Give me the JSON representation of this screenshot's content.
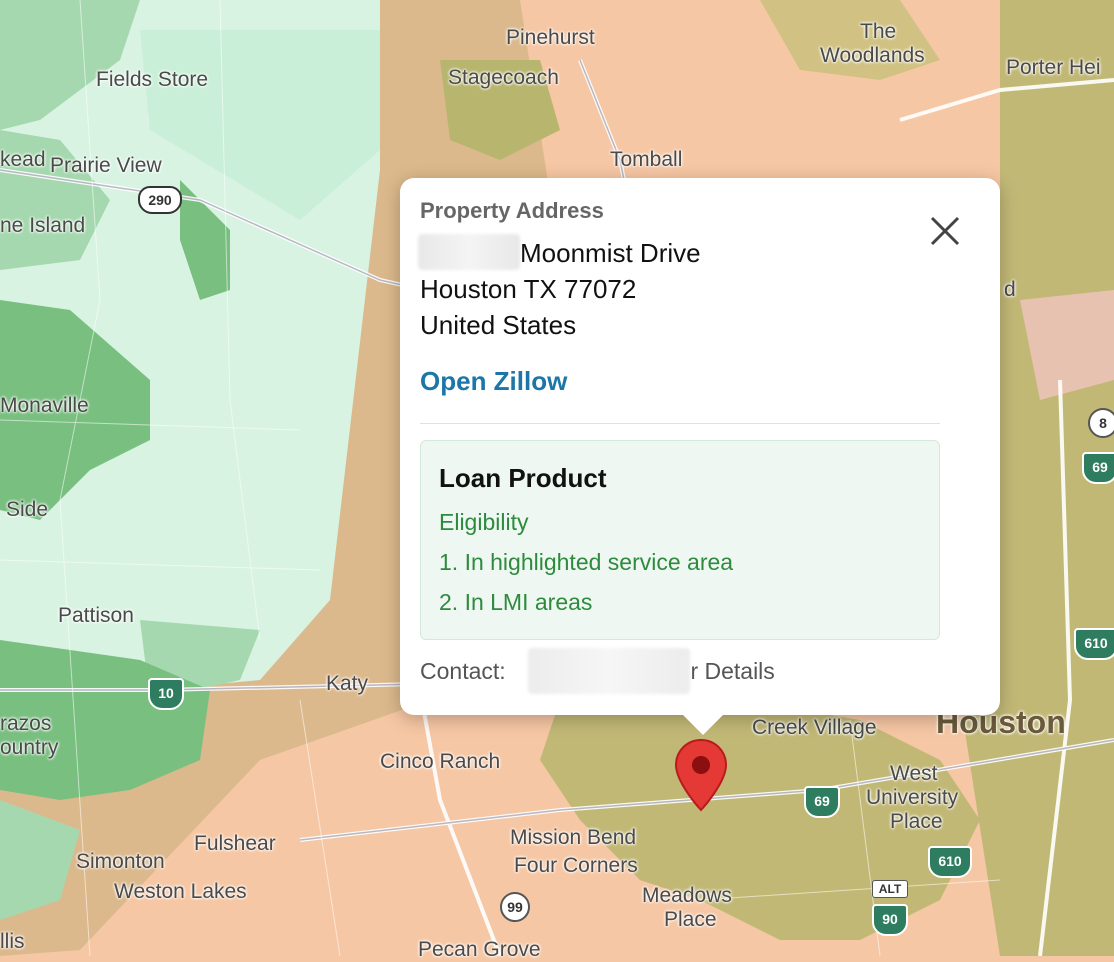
{
  "map": {
    "places": [
      {
        "key": "pinehurst",
        "label": "Pinehurst"
      },
      {
        "key": "woodlands1",
        "label": "The"
      },
      {
        "key": "woodlands2",
        "label": "Woodlands"
      },
      {
        "key": "porter",
        "label": "Porter Hei"
      },
      {
        "key": "fields",
        "label": "Fields Store"
      },
      {
        "key": "stagecoach",
        "label": "Stagecoach"
      },
      {
        "key": "prairie",
        "label": "Prairie View"
      },
      {
        "key": "kead",
        "label": "kead"
      },
      {
        "key": "tomball",
        "label": "Tomball"
      },
      {
        "key": "island",
        "label": "ne Island"
      },
      {
        "key": "monaville",
        "label": "Monaville"
      },
      {
        "key": "side",
        "label": "Side"
      },
      {
        "key": "pattison",
        "label": "Pattison"
      },
      {
        "key": "katy",
        "label": "Katy"
      },
      {
        "key": "brazos1",
        "label": "razos"
      },
      {
        "key": "brazos2",
        "label": "ountry"
      },
      {
        "key": "cinco",
        "label": "Cinco Ranch"
      },
      {
        "key": "creek",
        "label": "Creek Village"
      },
      {
        "key": "houston",
        "label": "Houston"
      },
      {
        "key": "westu1",
        "label": "West"
      },
      {
        "key": "westu2",
        "label": "University"
      },
      {
        "key": "westu3",
        "label": "Place"
      },
      {
        "key": "mission1",
        "label": "Mission Bend"
      },
      {
        "key": "mission2",
        "label": "Four Corners"
      },
      {
        "key": "fulshear",
        "label": "Fulshear"
      },
      {
        "key": "simonton",
        "label": "Simonton"
      },
      {
        "key": "weston",
        "label": "Weston Lakes"
      },
      {
        "key": "meadows1",
        "label": "Meadows"
      },
      {
        "key": "meadows2",
        "label": "Place"
      },
      {
        "key": "pecan",
        "label": "Pecan Grove"
      },
      {
        "key": "llis",
        "label": "llis"
      },
      {
        "key": "d",
        "label": "d"
      }
    ],
    "shields": [
      {
        "key": "us290",
        "label": "290"
      },
      {
        "key": "i10",
        "label": "10"
      },
      {
        "key": "us69a",
        "label": "69"
      },
      {
        "key": "us69b",
        "label": "69"
      },
      {
        "key": "i610a",
        "label": "610"
      },
      {
        "key": "i610b",
        "label": "610"
      },
      {
        "key": "s99",
        "label": "99"
      },
      {
        "key": "s8",
        "label": "8"
      },
      {
        "key": "alt",
        "label": "ALT"
      },
      {
        "key": "us90",
        "label": "90"
      }
    ],
    "colors": {
      "tan": "#f6c7a4",
      "olive": "#b8b56e",
      "light_green": "#d8f3e2",
      "mid_green": "#a5d8ae",
      "dark_green": "#79bf80",
      "brown_zone": "#dcb98c"
    }
  },
  "popup": {
    "label": "Property Address",
    "address_line1": "Moonmist Drive",
    "address_line2": "Houston TX 77072",
    "address_line3": "United States",
    "zillow_link": "Open Zillow",
    "loan_title": "Loan Product",
    "eligibility": "Eligibility",
    "item1": "1. In highlighted service area",
    "item2": "2. In LMI areas",
    "contact_label": "Contact:",
    "contact_suffix": "r Details",
    "close_icon": "close-icon"
  },
  "pin": {
    "icon": "map-pin-icon",
    "color": "#e53935"
  }
}
